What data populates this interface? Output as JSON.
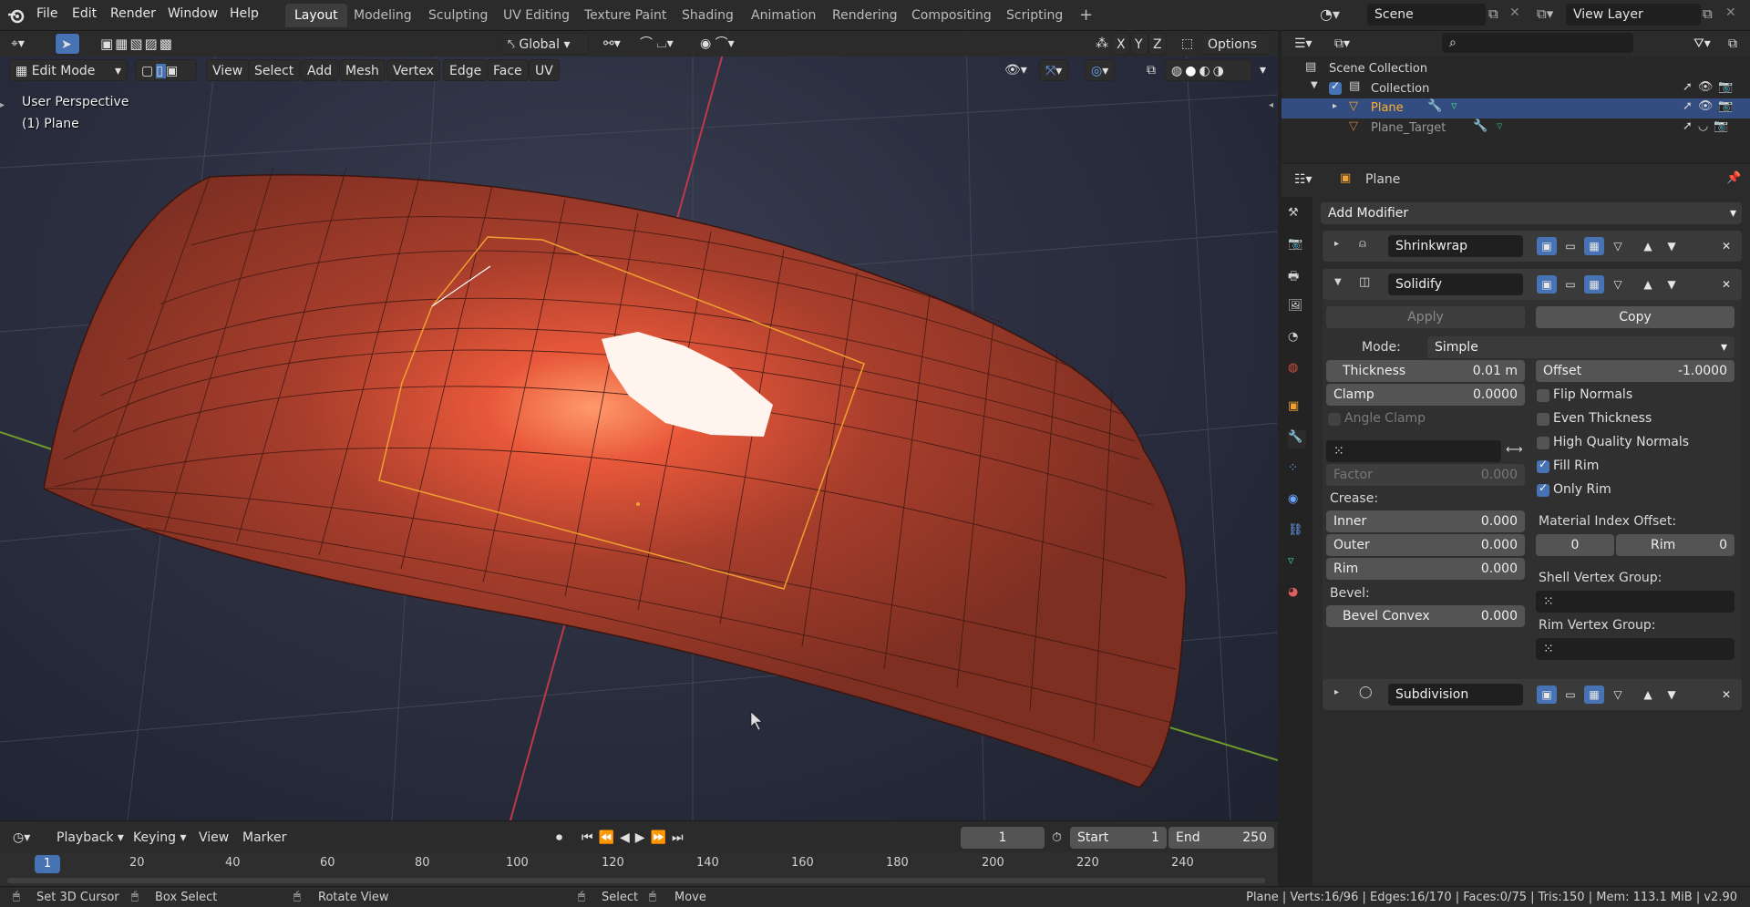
{
  "topbar": {
    "menus": [
      "File",
      "Edit",
      "Render",
      "Window",
      "Help"
    ],
    "workspaces": [
      "Layout",
      "Modeling",
      "Sculpting",
      "UV Editing",
      "Texture Paint",
      "Shading",
      "Animation",
      "Rendering",
      "Compositing",
      "Scripting"
    ],
    "add_tab": "+",
    "scene": "Scene",
    "view_layer": "View Layer"
  },
  "viewport": {
    "mode": "Edit Mode",
    "menus": [
      "View",
      "Select",
      "Add",
      "Mesh",
      "Vertex",
      "Edge",
      "Face",
      "UV"
    ],
    "transform_orientation": "Global",
    "axes": [
      "X",
      "Y",
      "Z"
    ],
    "options": "Options",
    "perspective": "User Perspective",
    "object": "(1) Plane"
  },
  "timeline": {
    "menus": [
      "Playback",
      "Keying",
      "View",
      "Marker"
    ],
    "current_frame": "1",
    "start_label": "Start",
    "start": "1",
    "end_label": "End",
    "end": "250",
    "ticks": [
      "20",
      "40",
      "60",
      "80",
      "100",
      "120",
      "140",
      "160",
      "180",
      "200",
      "220",
      "240"
    ],
    "playhead": "1"
  },
  "status": {
    "set_cursor": "Set 3D Cursor",
    "box_select": "Box Select",
    "rotate": "Rotate View",
    "select": "Select",
    "move": "Move",
    "stats": "Plane | Verts:16/96 | Edges:16/170 | Faces:0/75 | Tris:150 | Mem: 113.1 MiB | v2.90"
  },
  "outliner": {
    "scene_collection": "Scene Collection",
    "collection": "Collection",
    "items": [
      "Plane",
      "Plane_Target"
    ]
  },
  "properties": {
    "object": "Plane",
    "add_modifier": "Add Modifier",
    "modifiers": [
      "Shrinkwrap",
      "Solidify",
      "Subdivision"
    ],
    "apply": "Apply",
    "copy": "Copy",
    "mode_label": "Mode:",
    "mode_value": "Simple",
    "thickness_label": "Thickness",
    "thickness": "0.01 m",
    "offset_label": "Offset",
    "offset": "-1.0000",
    "clamp_label": "Clamp",
    "clamp": "0.0000",
    "angle_clamp": "Angle Clamp",
    "flip_normals": "Flip Normals",
    "even_thickness": "Even Thickness",
    "hq_normals": "High Quality Normals",
    "fill_rim": "Fill Rim",
    "only_rim": "Only Rim",
    "factor_label": "Factor",
    "factor": "0.000",
    "crease_label": "Crease:",
    "inner_label": "Inner",
    "inner": "0.000",
    "outer_label": "Outer",
    "outer": "0.000",
    "rim_label": "Rim",
    "rim": "0.000",
    "bevel_label": "Bevel:",
    "bevel_convex_label": "Bevel Convex",
    "bevel_convex": "0.000",
    "mat_offset_label": "Material Index Offset:",
    "mat_offset": "0",
    "mat_rim_label": "Rim",
    "mat_rim": "0",
    "shell_vg_label": "Shell Vertex Group:",
    "rim_vg_label": "Rim Vertex Group:"
  },
  "colors": {
    "accent": "#4772b3",
    "selection": "#f0a030",
    "mesh": "#9b3a2a"
  }
}
